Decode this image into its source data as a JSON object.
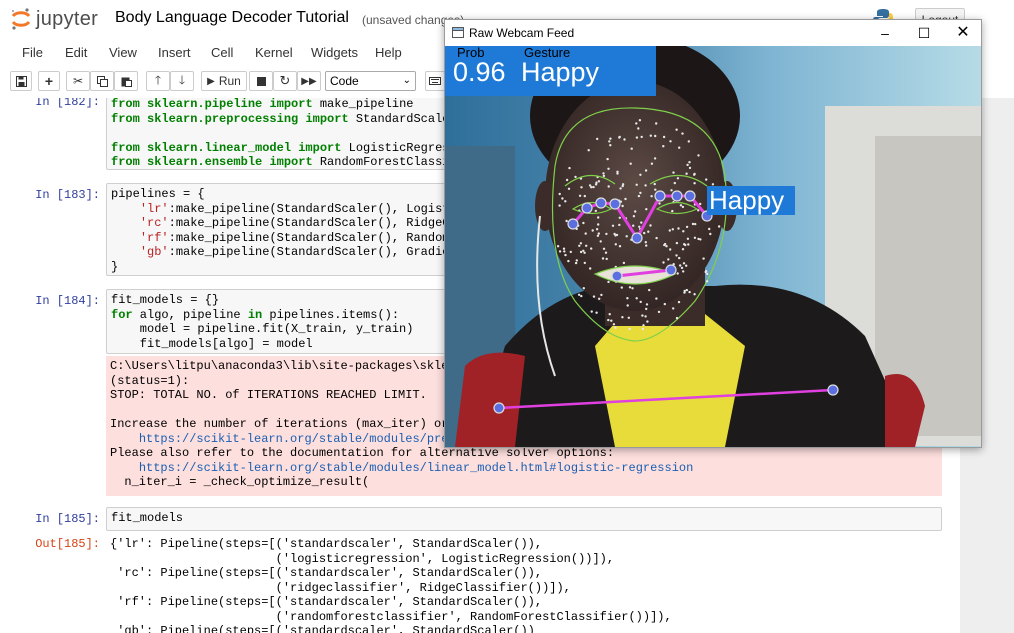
{
  "header": {
    "logo_text": "jupyter",
    "notebook_title": "Body Language Decoder Tutorial",
    "save_status": "(unsaved changes)",
    "logout_label": "Logout"
  },
  "menu": [
    "File",
    "Edit",
    "View",
    "Insert",
    "Cell",
    "Kernel",
    "Widgets",
    "Help"
  ],
  "toolbar": {
    "run_label": "Run",
    "cell_type": "Code",
    "icons": [
      "save-icon",
      "plus-icon",
      "scissors-icon",
      "copy-icon",
      "paste-icon",
      "arrow-up-icon",
      "arrow-down-icon",
      "run-icon",
      "stop-icon",
      "restart-icon",
      "fast-forward-icon",
      "keyboard-icon"
    ]
  },
  "cells": {
    "c182": {
      "prompt": "In [182]:",
      "lines": [
        [
          "from sklearn.pipeline ",
          "import",
          " make_pipeline"
        ],
        [
          "from sklearn.preprocessing ",
          "import",
          " StandardScaler"
        ],
        [
          "from sklearn.linear_model ",
          "import",
          " LogisticRegression,"
        ],
        [
          "from sklearn.ensemble ",
          "import",
          " RandomForestClassifier,"
        ]
      ]
    },
    "c183": {
      "prompt": "In [183]:",
      "l1": "pipelines = {",
      "l2k": "'lr'",
      "l2": ":make_pipeline(StandardScaler(), LogisticReg",
      "l3k": "'rc'",
      "l3": ":make_pipeline(StandardScaler(), RidgeClassi",
      "l4k": "'rf'",
      "l4": ":make_pipeline(StandardScaler(), RandomFores",
      "l5k": "'gb'",
      "l5": ":make_pipeline(StandardScaler(), GradientBoo",
      "l6": "}"
    },
    "c184": {
      "prompt": "In [184]:",
      "l1": "fit_models = {}",
      "l2a": "for",
      "l2b": " algo, pipeline ",
      "l2c": "in",
      "l2d": " pipelines.items():",
      "l3": "    model = pipeline.fit(X_train, y_train)",
      "l4": "    fit_models[algo] = model",
      "stderr": {
        "l1": "C:\\Users\\litpu\\anaconda3\\lib\\site-packages\\sklearn\\l",
        "l2": "(status=1):",
        "l3": "STOP: TOTAL NO. of ITERATIONS REACHED LIMIT.",
        "l4": "Increase the number of iterations (max_iter) or scal",
        "l5": "https://scikit-learn.org/stable/modules/preproce",
        "l6": "Please also refer to the documentation for alternative solver options:",
        "l7": "https://scikit-learn.org/stable/modules/linear_model.html#logistic-regression",
        "l8": "  n_iter_i = _check_optimize_result("
      }
    },
    "c185": {
      "prompt": "In [185]:",
      "code": "fit_models",
      "out_prompt": "Out[185]:",
      "output": [
        "{'lr': Pipeline(steps=[('standardscaler', StandardScaler()),",
        "                       ('logisticregression', LogisticRegression())]),",
        " 'rc': Pipeline(steps=[('standardscaler', StandardScaler()),",
        "                       ('ridgeclassifier', RidgeClassifier())]),",
        " 'rf': Pipeline(steps=[('standardscaler', StandardScaler()),",
        "                       ('randomforestclassifier', RandomForestClassifier())]),",
        " 'gb': Pipeline(steps=[('standardscaler', StandardScaler())"
      ]
    }
  },
  "webcam": {
    "window_title": "Raw Webcam Feed",
    "prob_header": "Prob",
    "gesture_header": "Gesture",
    "prob_value": "0.96",
    "gesture_value": "Happy",
    "face_label": "Happy",
    "label_color": "#1e7ad6",
    "landmark_color": "#7fd04a",
    "pose_color": "#e040e0"
  }
}
